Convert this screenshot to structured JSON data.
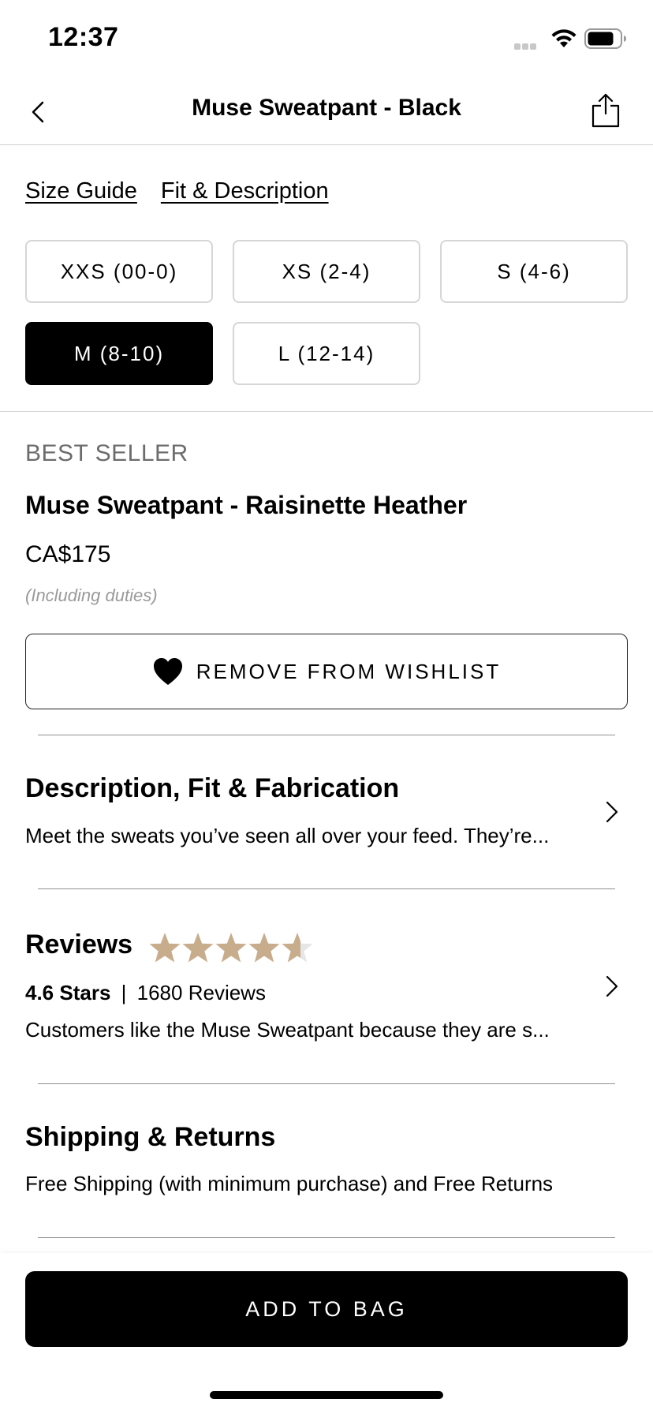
{
  "status_bar": {
    "time": "12:37"
  },
  "nav": {
    "title": "Muse Sweatpant - Black"
  },
  "links": {
    "size_guide": "Size Guide",
    "fit_description": "Fit & Description"
  },
  "sizes": [
    {
      "label": "XXS (00-0)",
      "selected": false
    },
    {
      "label": "XS (2-4)",
      "selected": false
    },
    {
      "label": "S (4-6)",
      "selected": false
    },
    {
      "label": "M (8-10)",
      "selected": true
    },
    {
      "label": "L (12-14)",
      "selected": false
    }
  ],
  "product": {
    "badge": "BEST SELLER",
    "name": "Muse Sweatpant - Raisinette Heather",
    "price": "CA$175",
    "duties_note": "(Including duties)"
  },
  "wishlist": {
    "label": "REMOVE FROM WISHLIST",
    "icon": "heart-filled-icon"
  },
  "description": {
    "title": "Description, Fit & Fabrication",
    "text": "Meet the sweats you’ve seen all over your feed. They’re..."
  },
  "reviews": {
    "title": "Reviews",
    "rating": 4.6,
    "rating_label": "4.6 Stars",
    "separator": "|",
    "count_label": "1680 Reviews",
    "text": "Customers like the Muse Sweatpant because they are s..."
  },
  "shipping": {
    "title": "Shipping & Returns",
    "text": "Free Shipping (with minimum purchase) and Free Returns"
  },
  "cta": {
    "label": "ADD TO BAG"
  },
  "colors": {
    "star": "#c8ad8d",
    "star_empty": "#e6e6e6",
    "primary": "#000000"
  }
}
